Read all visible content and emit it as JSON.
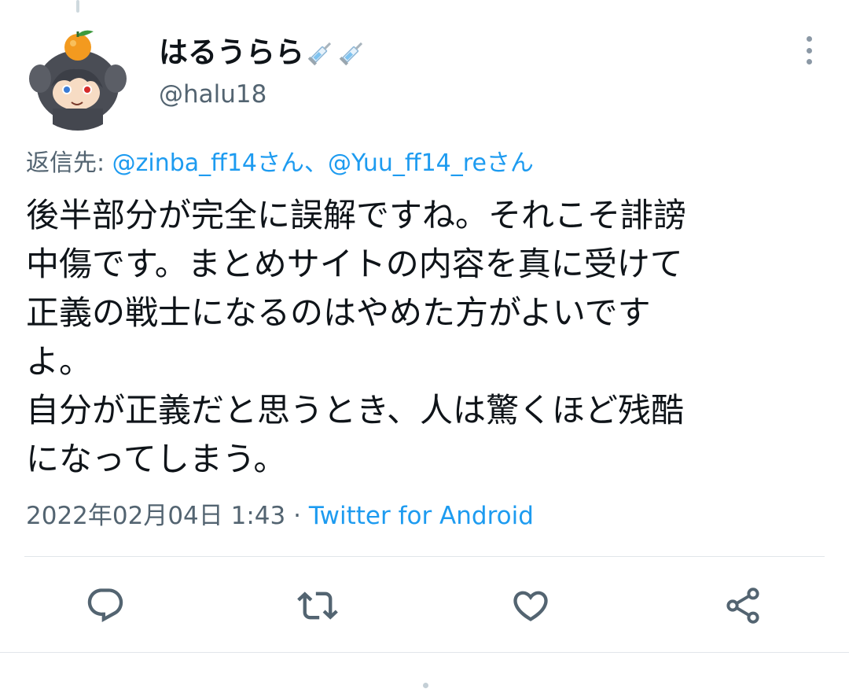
{
  "user": {
    "display_name": "はるうらら",
    "handle": "@halu18",
    "emoji_icons": [
      "syringe-icon",
      "syringe-icon"
    ]
  },
  "reply_to": {
    "prefix": "返信先: ",
    "mentions": "@zinba_ff14さん、@Yuu_ff14_reさん"
  },
  "tweet": {
    "lines": [
      "後半部分が完全に誤解ですね。それこそ誹謗",
      "中傷です。まとめサイトの内容を真に受けて",
      "正義の戦士になるのはやめた方がよいです",
      "よ。",
      "自分が正義だと思うとき、人は驚くほど残酷",
      "になってしまう。"
    ]
  },
  "meta": {
    "timestamp": "2022年02月04日 1:43",
    "separator": " · ",
    "source": "Twitter for Android"
  },
  "actions": {
    "icons": [
      "reply-icon",
      "retweet-icon",
      "like-icon",
      "share-icon"
    ]
  },
  "colors": {
    "accent": "#1d9bf0",
    "text": "#0f1419",
    "secondary": "#536471",
    "divider": "#e1e6ea"
  }
}
